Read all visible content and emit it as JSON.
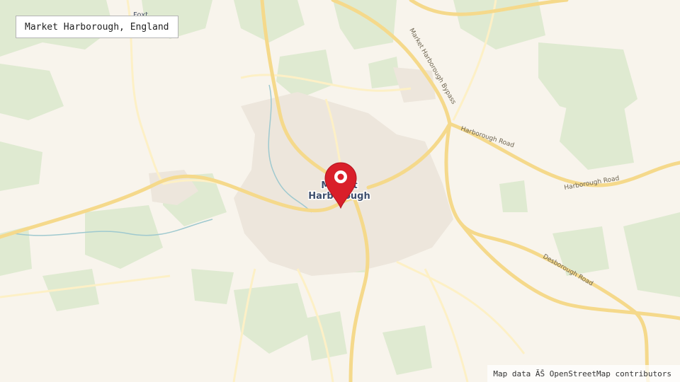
{
  "map": {
    "place_name": "Market Harborough, England",
    "town_label_line1": "Market",
    "town_label_line2": "Harborough",
    "village_label": "Foxt",
    "attribution": "Map data ĂŠ OpenStreetMap contributors",
    "roads": {
      "bypass": "Market Harborough Bypass",
      "harborough_road_1": "Harborough Road",
      "harborough_road_2": "Harborough Road",
      "desborough_road": "Desborough Road"
    },
    "marker": {
      "icon": "map-pin-icon",
      "color": "#d91f2a"
    },
    "colors": {
      "background": "#f8f4ec",
      "woodland": "#dfead1",
      "urban": "#ede6dc",
      "major_road": "#f5d98b",
      "minor_road": "#fdf0c6",
      "water": "#9fc9cf"
    }
  }
}
